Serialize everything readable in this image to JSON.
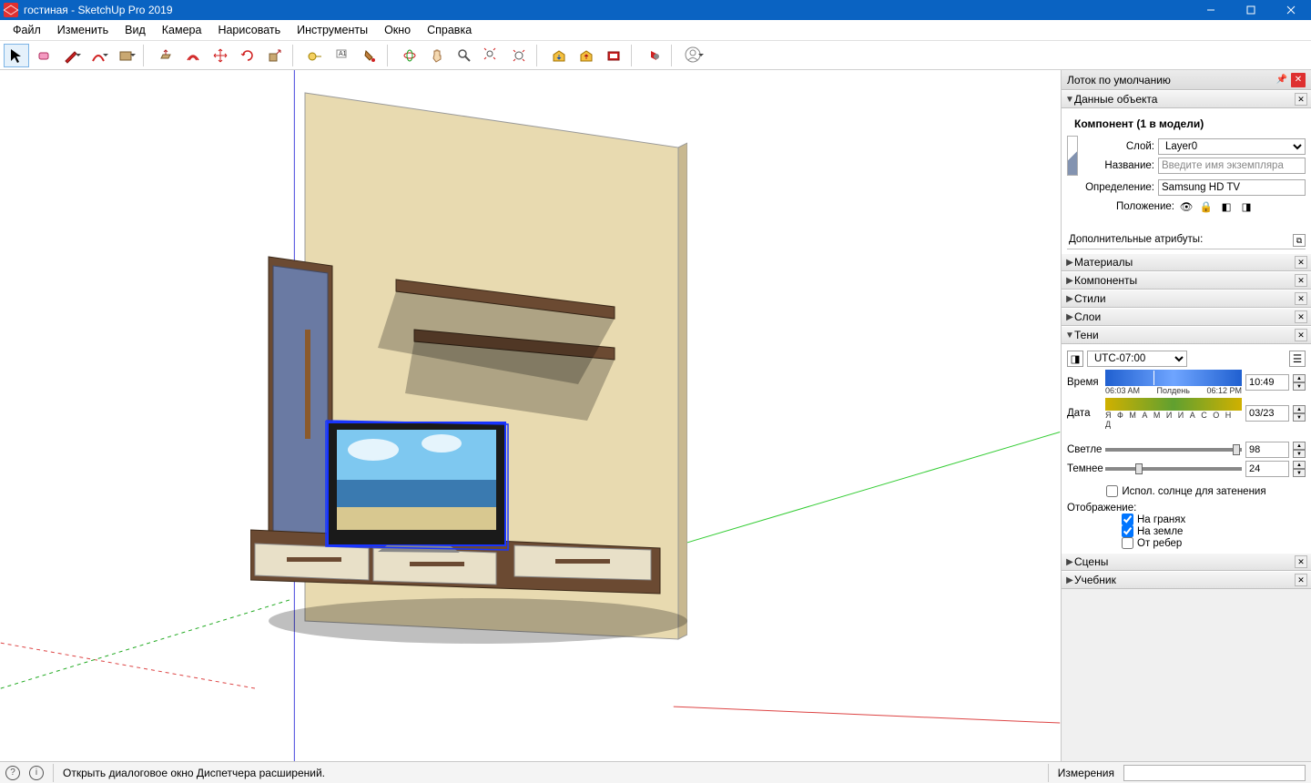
{
  "titlebar": {
    "title": "гостиная - SketchUp Pro 2019"
  },
  "menu": [
    "Файл",
    "Изменить",
    "Вид",
    "Камера",
    "Нарисовать",
    "Инструменты",
    "Окно",
    "Справка"
  ],
  "toolbar_icons": [
    "select-arrow",
    "eraser",
    "pencil",
    "arc",
    "shape",
    "pushpull",
    "offset",
    "move",
    "rotate",
    "scale",
    "tape",
    "text",
    "paint",
    "orbit",
    "pan",
    "zoom",
    "zoom-extents",
    "prev-view",
    "next-view",
    "section",
    "3dwarehouse-get",
    "3dwarehouse-send",
    "extension-warehouse",
    "extension-manager",
    "user-profile"
  ],
  "tray": {
    "title": "Лоток по умолчанию",
    "panels": {
      "entity": {
        "title": "Данные объекта",
        "component_summary": "Компонент (1 в модели)",
        "layer_label": "Слой:",
        "layer_value": "Layer0",
        "name_label": "Название:",
        "name_placeholder": "Введите имя экземпляра",
        "definition_label": "Определение:",
        "definition_value": "Samsung HD TV",
        "position_label": "Положение:",
        "attrs_label": "Дополнительные атрибуты:"
      },
      "collapsed": [
        "Материалы",
        "Компоненты",
        "Стили",
        "Слои"
      ],
      "shadows": {
        "title": "Тени",
        "tz": "UTC-07:00",
        "time_label": "Время",
        "time_lo": "06:03 AM",
        "time_mid": "Полдень",
        "time_hi": "06:12 PM",
        "time_value": "10:49",
        "date_label": "Дата",
        "months": "Я Ф М А М И И А С О Н Д",
        "date_value": "03/23",
        "light_label": "Светле",
        "light_value": "98",
        "dark_label": "Темнее",
        "dark_value": "24",
        "sunshade": "Испол. солнце для затенения",
        "display_label": "Отображение:",
        "onfaces": "На гранях",
        "onground": "На земле",
        "fromedges": "От ребер"
      },
      "trailing": [
        "Сцены",
        "Учебник"
      ]
    }
  },
  "statusbar": {
    "hint": "Открыть диалоговое окно Диспетчера расширений.",
    "measure_label": "Измерения"
  }
}
